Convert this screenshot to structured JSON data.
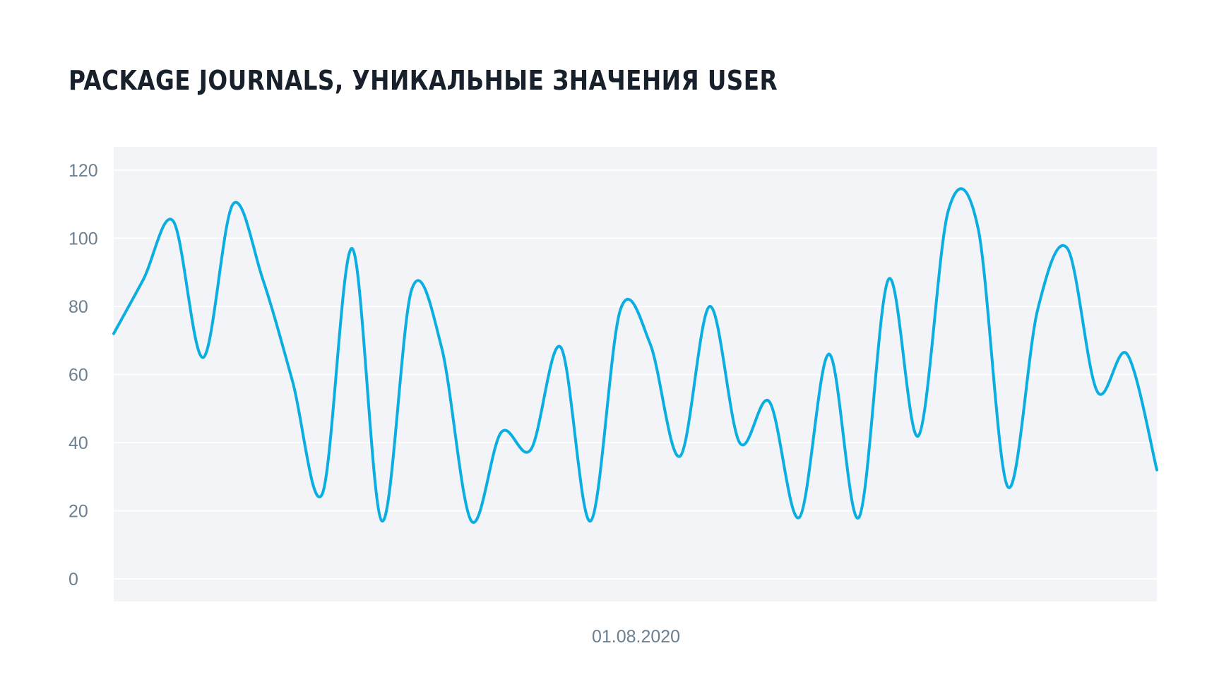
{
  "chart_data": {
    "type": "line",
    "title": "PACKAGE JOURNALS, УНИКАЛЬНЫЕ ЗНАЧЕНИЯ USER",
    "xlabel": "",
    "ylabel": "",
    "ylim": [
      0,
      120
    ],
    "yticks": [
      0,
      20,
      40,
      60,
      80,
      100,
      120
    ],
    "xtick_labels": [
      "01.08.2020"
    ],
    "grid": true,
    "legend": "none",
    "colors": {
      "line": "#0aaee0",
      "plot_bg": "#f2f4f7",
      "grid": "#ffffff",
      "title": "#17202b",
      "tick": "#6b7f91"
    },
    "series": [
      {
        "values": [
          72,
          88,
          105,
          65,
          110,
          88,
          58,
          25,
          97,
          17,
          85,
          68,
          17,
          43,
          38,
          68,
          17,
          79,
          69,
          36,
          80,
          40,
          52,
          18,
          66,
          18,
          88,
          42,
          108,
          103,
          27,
          79,
          97,
          55,
          66,
          32
        ]
      }
    ]
  }
}
